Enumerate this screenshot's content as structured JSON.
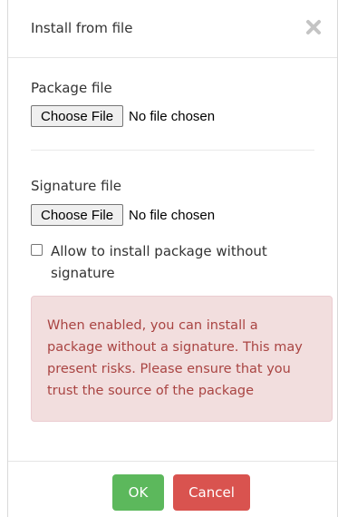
{
  "dialog": {
    "title": "Install from file",
    "close_icon": "close-x-icon"
  },
  "package": {
    "label": "Package file",
    "choose_label": "Choose File",
    "status": "No file chosen"
  },
  "signature": {
    "label": "Signature file",
    "choose_label": "Choose File",
    "status": "No file chosen"
  },
  "allow_unsigned": {
    "label": "Allow to install package without signature",
    "checked": false
  },
  "alert": {
    "text": "When enabled, you can install a package without a signature. This may present risks. Please ensure that you trust the source of the package"
  },
  "footer": {
    "ok_label": "OK",
    "cancel_label": "Cancel"
  },
  "colors": {
    "ok": "#5cb85c",
    "cancel": "#d9534f",
    "alert_bg": "#f2dede",
    "alert_text": "#a94442"
  }
}
